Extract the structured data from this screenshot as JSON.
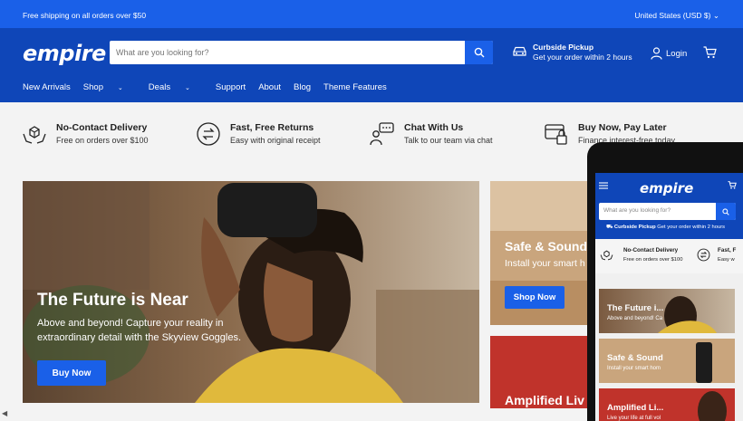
{
  "topbar": {
    "shipping": "Free shipping on all orders over $50",
    "locale": "United States (USD $)"
  },
  "header": {
    "logo": "empire",
    "search_placeholder": "What are you looking for?",
    "pickup_title": "Curbside Pickup",
    "pickup_sub": "Get your order within 2 hours",
    "login": "Login"
  },
  "nav": {
    "items": [
      "New Arrivals",
      "Shop",
      "Deals",
      "Support",
      "About",
      "Blog",
      "Theme Features"
    ]
  },
  "features": [
    {
      "title": "No-Contact Delivery",
      "sub": "Free on orders over $100",
      "icon": "box-hands-icon"
    },
    {
      "title": "Fast, Free Returns",
      "sub": "Easy with original receipt",
      "icon": "returns-icon"
    },
    {
      "title": "Chat With Us",
      "sub": "Talk to our team via chat",
      "icon": "chat-icon"
    },
    {
      "title": "Buy Now, Pay Later",
      "sub": "Finance interest-free today",
      "icon": "finance-icon"
    }
  ],
  "hero": {
    "title": "The Future is Near",
    "sub": "Above and beyond! Capture your reality in extraordinary detail with the Skyview Goggles.",
    "button": "Buy Now"
  },
  "cards": [
    {
      "title": "Safe & Sound",
      "sub": "Install your smart h",
      "button": "Shop Now"
    },
    {
      "title": "Amplified Liv"
    }
  ],
  "mobile": {
    "logo": "empire",
    "search_placeholder": "What are you looking for?",
    "pickup_title": "Curbside Pickup",
    "pickup_sub": "Get your order within 2 hours",
    "feat1_title": "No-Contact Delivery",
    "feat1_sub": "Free on orders over $100",
    "feat2_title": "Fast, F",
    "feat2_sub": "Easy w",
    "cards": [
      {
        "title": "The Future i...",
        "sub": "Above and beyond! Ca"
      },
      {
        "title": "Safe & Sound",
        "sub": "Install your smart hom"
      },
      {
        "title": "Amplified Li...",
        "sub": "Live your life at full vol"
      }
    ]
  },
  "colors": {
    "topbar": "#1a60e8",
    "header": "#0f46b8",
    "button": "#1a60e8"
  }
}
